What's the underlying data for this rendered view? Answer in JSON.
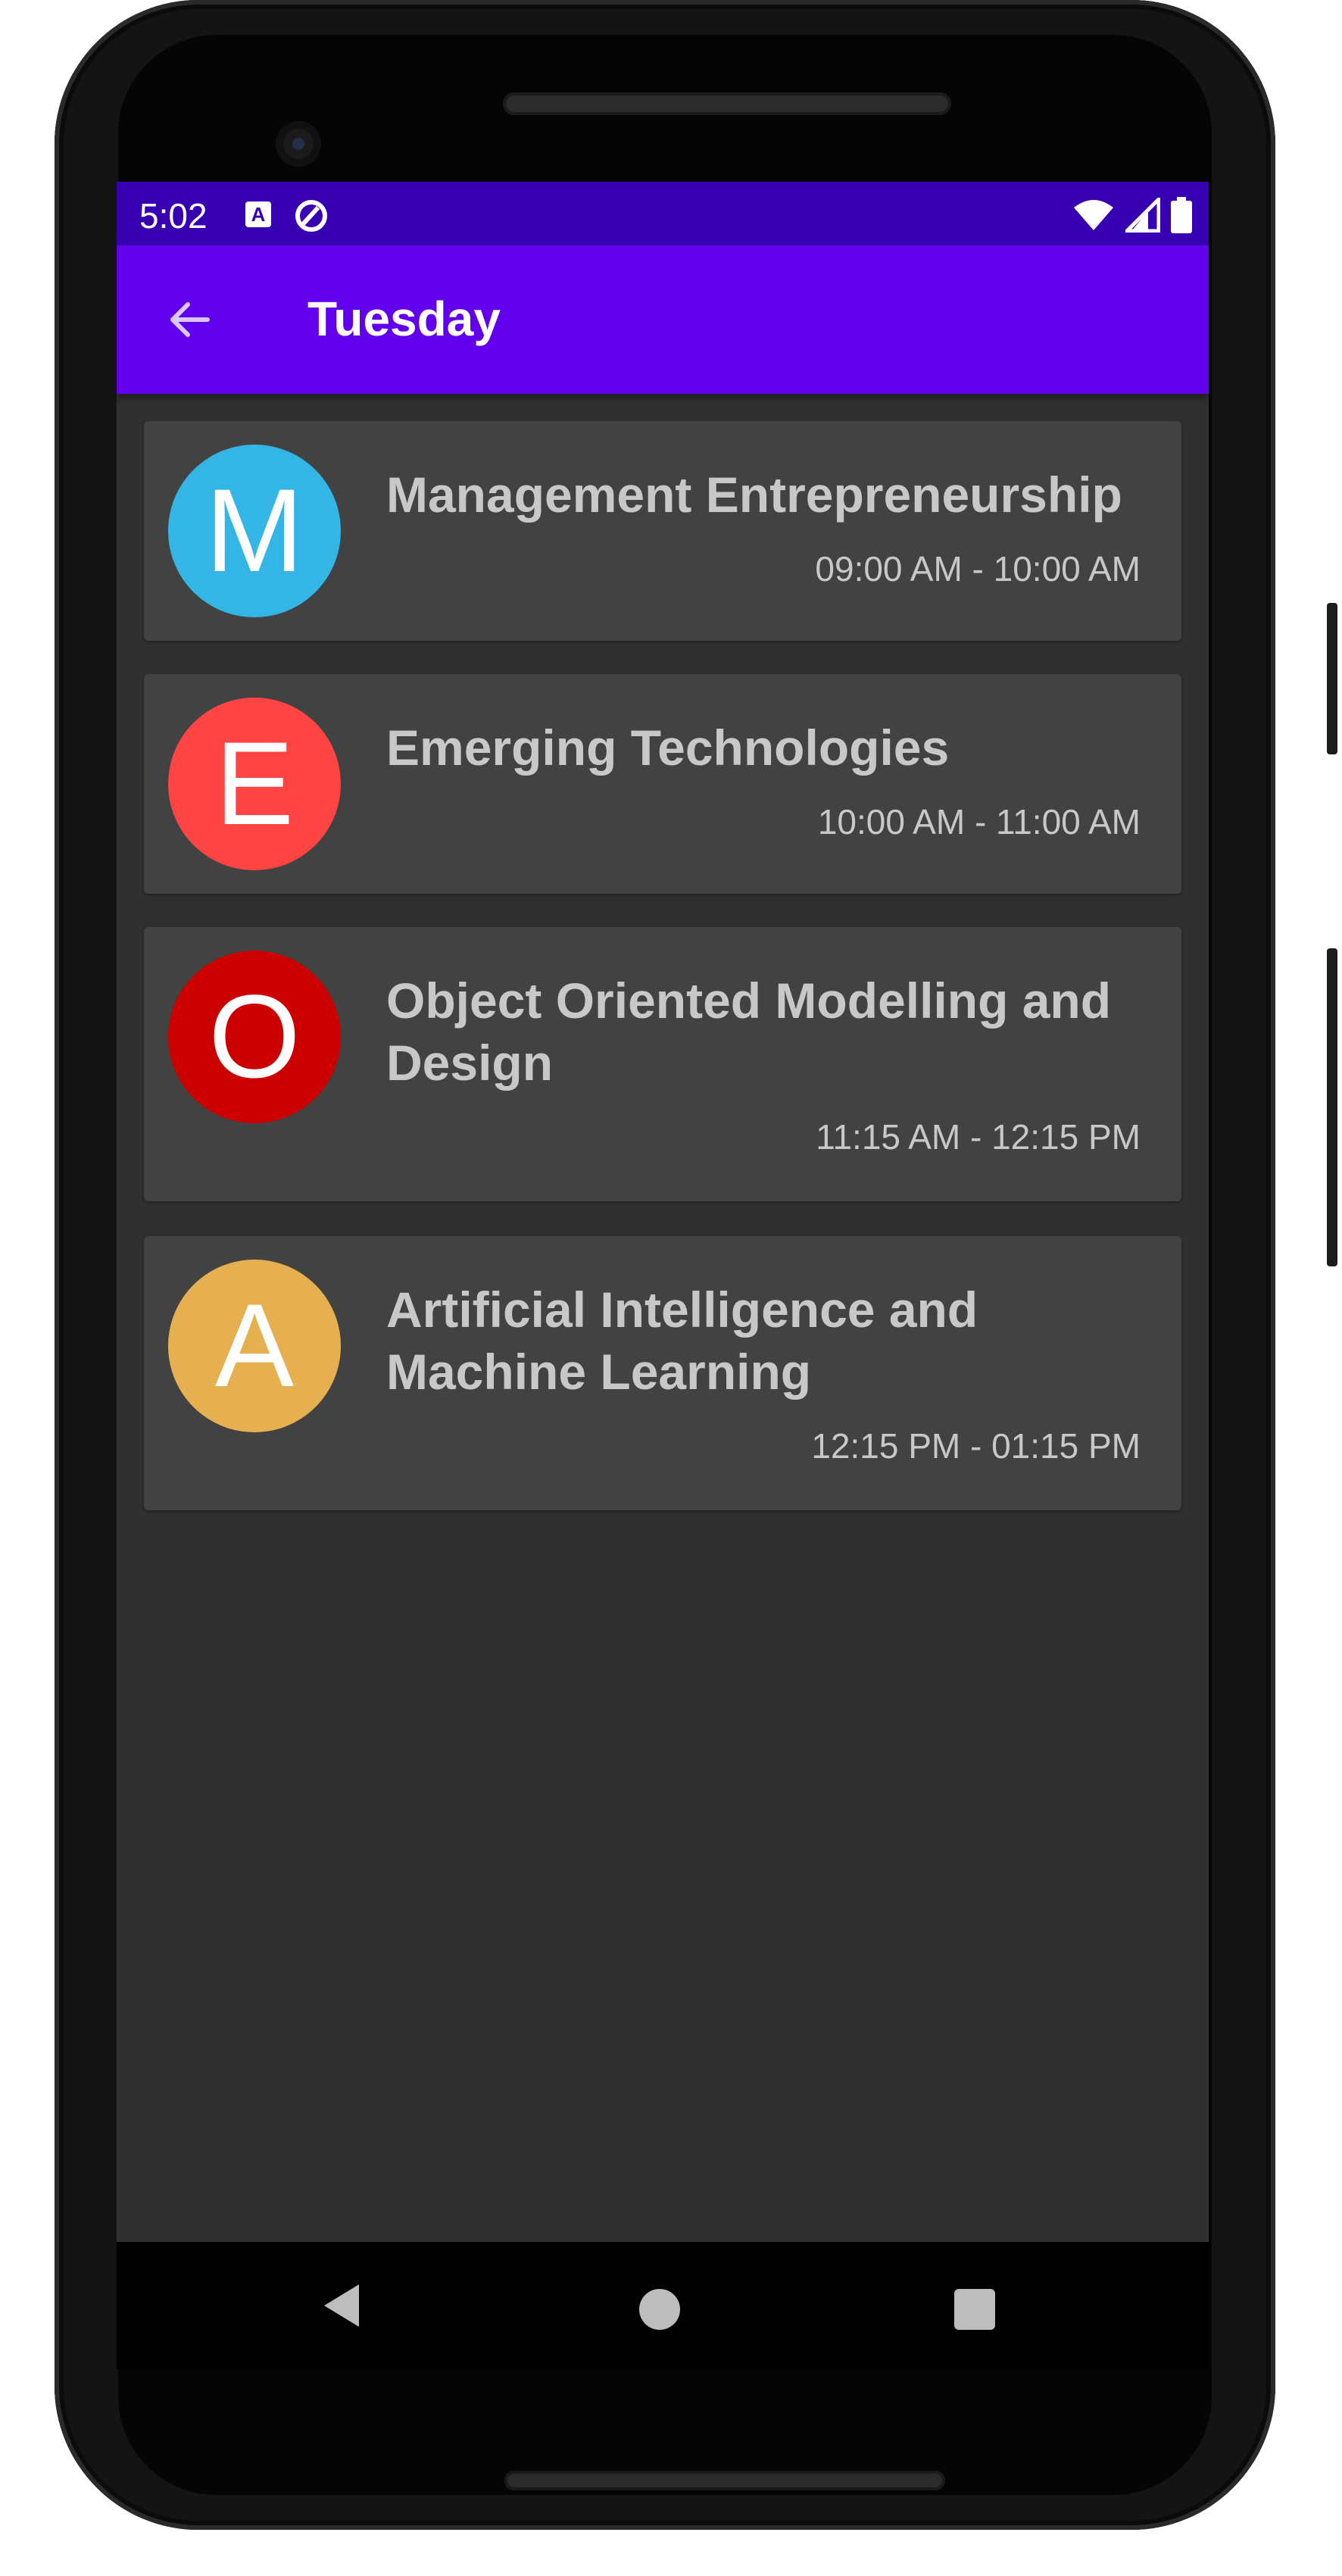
{
  "status_bar": {
    "time": "5:02",
    "accessibility_icon": "a-badge-icon",
    "rotate_icon": "auto-rotate-icon",
    "wifi_icon": "wifi-icon",
    "signal_icon": "cell-signal-icon",
    "battery_icon": "battery-icon"
  },
  "app_bar": {
    "title": "Tuesday",
    "back_icon": "arrow-back-icon",
    "color": "#6200ee",
    "status_color": "#3700b3"
  },
  "schedule": [
    {
      "letter": "M",
      "subject": "Management Entrepreneurship",
      "time": "09:00 AM - 10:00 AM",
      "color": "#33b5e5"
    },
    {
      "letter": "E",
      "subject": "Emerging Technologies",
      "time": "10:00 AM - 11:00 AM",
      "color": "#ff4444"
    },
    {
      "letter": "O",
      "subject": "Object Oriented Modelling and Design",
      "time": "11:15 AM - 12:15 PM",
      "color": "#cc0000"
    },
    {
      "letter": "A",
      "subject": "Artificial Intelligence and Machine Learning",
      "time": "12:15 PM - 01:15 PM",
      "color": "#e6b050"
    }
  ],
  "nav_bar": {
    "back_icon": "nav-back-icon",
    "home_icon": "nav-home-icon",
    "recents_icon": "nav-recents-icon"
  }
}
